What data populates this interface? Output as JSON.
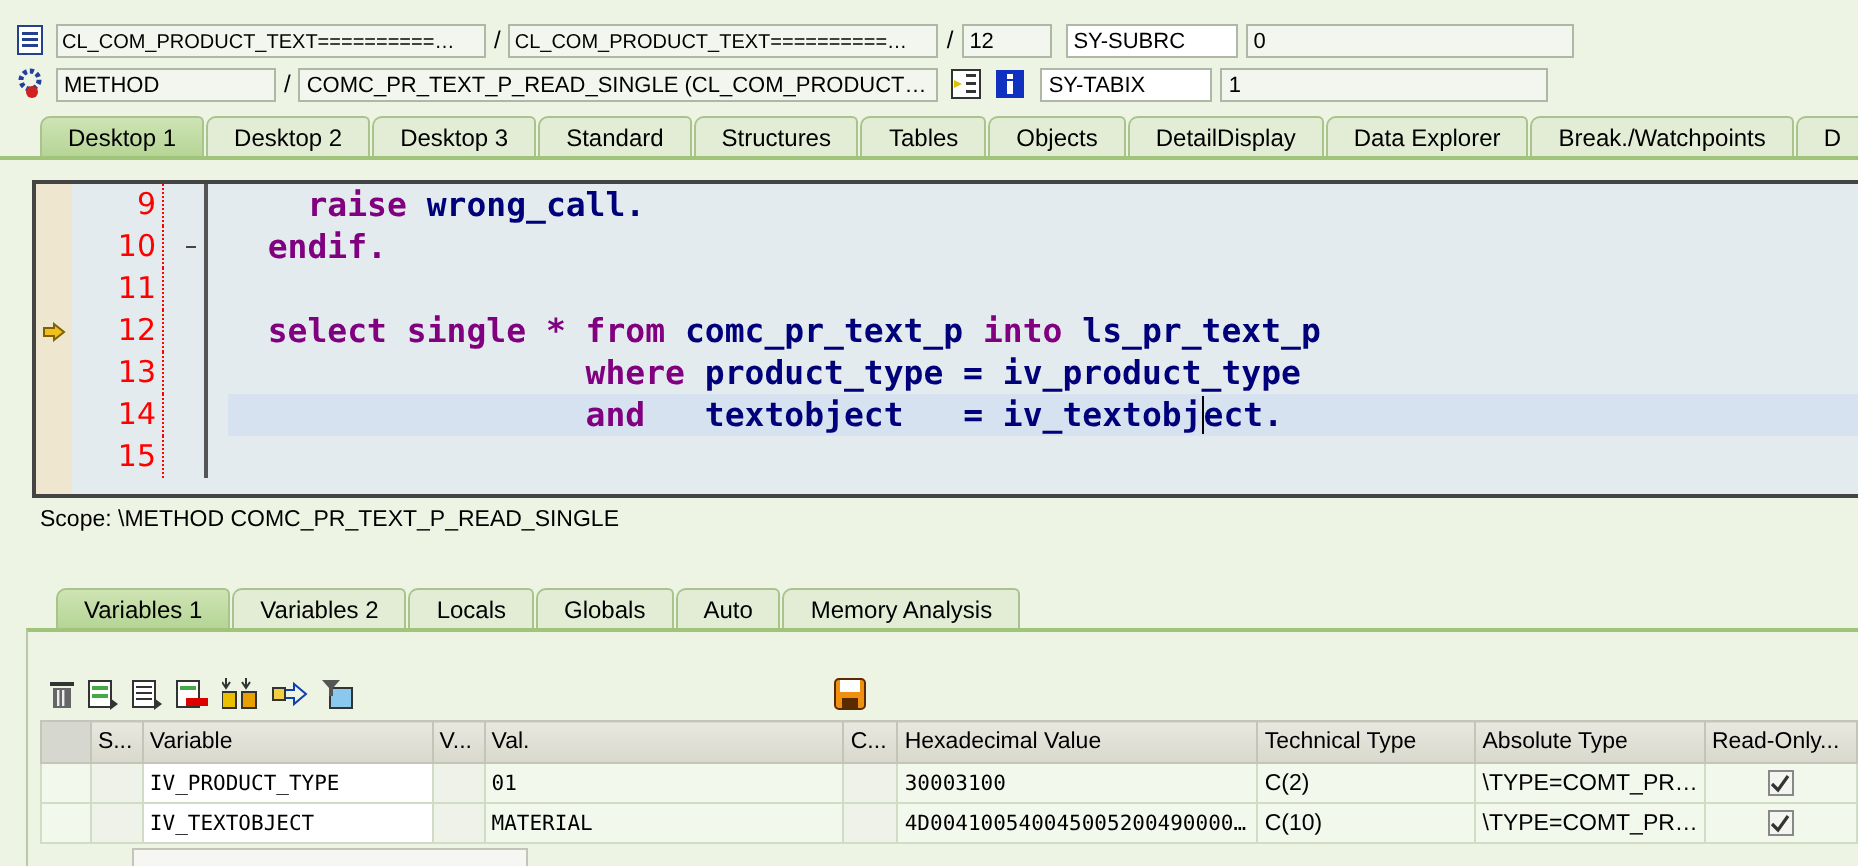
{
  "header": {
    "row1": {
      "fields": [
        "CL_COM_PRODUCT_TEXT==========…",
        "CL_COM_PRODUCT_TEXT==========…",
        "12"
      ],
      "sys_label": "SY-SUBRC",
      "sys_value": "0"
    },
    "row2": {
      "fields": [
        "METHOD",
        "COMC_PR_TEXT_P_READ_SINGLE (CL_COM_PRODUCT…"
      ],
      "sys_label": "SY-TABIX",
      "sys_value": "1"
    },
    "separator": "/"
  },
  "desktop_tabs": [
    {
      "label": "Desktop 1",
      "selected": true
    },
    {
      "label": "Desktop 2",
      "selected": false
    },
    {
      "label": "Desktop 3",
      "selected": false
    },
    {
      "label": "Standard",
      "selected": false
    },
    {
      "label": "Structures",
      "selected": false
    },
    {
      "label": "Tables",
      "selected": false
    },
    {
      "label": "Objects",
      "selected": false
    },
    {
      "label": "DetailDisplay",
      "selected": false
    },
    {
      "label": "Data Explorer",
      "selected": false
    },
    {
      "label": "Break./Watchpoints",
      "selected": false
    },
    {
      "label": "D",
      "selected": false
    }
  ],
  "editor": {
    "lines": [
      {
        "number": "9",
        "current": false,
        "cursor_line": false,
        "fold": false,
        "tokens": [
          {
            "text": "    raise",
            "kind": "keyword"
          },
          {
            "text": " wrong_call.",
            "kind": "identifier"
          }
        ]
      },
      {
        "number": "10",
        "current": false,
        "cursor_line": false,
        "fold": true,
        "tokens": [
          {
            "text": "  endif.",
            "kind": "keyword"
          }
        ]
      },
      {
        "number": "11",
        "current": false,
        "cursor_line": false,
        "fold": false
      },
      {
        "number": "12",
        "current": true,
        "cursor_line": false,
        "fold": false,
        "tokens": [
          {
            "text": "  select single * from",
            "kind": "keyword"
          },
          {
            "text": " comc_pr_text_p ",
            "kind": "identifier"
          },
          {
            "text": "into",
            "kind": "keyword"
          },
          {
            "text": " ls_pr_text_p",
            "kind": "identifier"
          }
        ]
      },
      {
        "number": "13",
        "current": false,
        "cursor_line": false,
        "fold": false,
        "tokens": [
          {
            "text": "                  where",
            "kind": "keyword"
          },
          {
            "text": " product_type = iv_product_type",
            "kind": "identifier"
          }
        ]
      },
      {
        "number": "14",
        "current": false,
        "cursor_line": true,
        "fold": false,
        "tokens": [
          {
            "text": "                  and",
            "kind": "keyword"
          },
          {
            "text": "   textobject   = iv_textobj",
            "kind": "identifier"
          },
          {
            "text": "ect.",
            "kind": "identifier",
            "cursor": true
          }
        ]
      },
      {
        "number": "15",
        "current": false,
        "cursor_line": false,
        "fold": false
      }
    ],
    "scope": "Scope: \\METHOD COMC_PR_TEXT_P_READ_SINGLE"
  },
  "variable_tabs": [
    {
      "label": "Variables 1",
      "selected": true
    },
    {
      "label": "Variables 2",
      "selected": false
    },
    {
      "label": "Locals",
      "selected": false
    },
    {
      "label": "Globals",
      "selected": false
    },
    {
      "label": "Auto",
      "selected": false
    },
    {
      "label": "Memory Analysis",
      "selected": false
    }
  ],
  "table": {
    "columns": [
      "S...",
      "Variable",
      "V...",
      "Val.",
      "C...",
      "Hexadecimal Value",
      "Technical Type",
      "Absolute Type",
      "Read-Only..."
    ],
    "rows": [
      {
        "variable": "IV_PRODUCT_TYPE",
        "value": "01",
        "hex": "30003100",
        "technical_type": "C(2)",
        "absolute_type": "\\TYPE=COMT_PR…",
        "read_only": true
      },
      {
        "variable": "IV_TEXTOBJECT",
        "value": "MATERIAL",
        "hex": "4D004100540045005200490000…",
        "technical_type": "C(10)",
        "absolute_type": "\\TYPE=COMT_PR…",
        "read_only": true
      }
    ]
  }
}
